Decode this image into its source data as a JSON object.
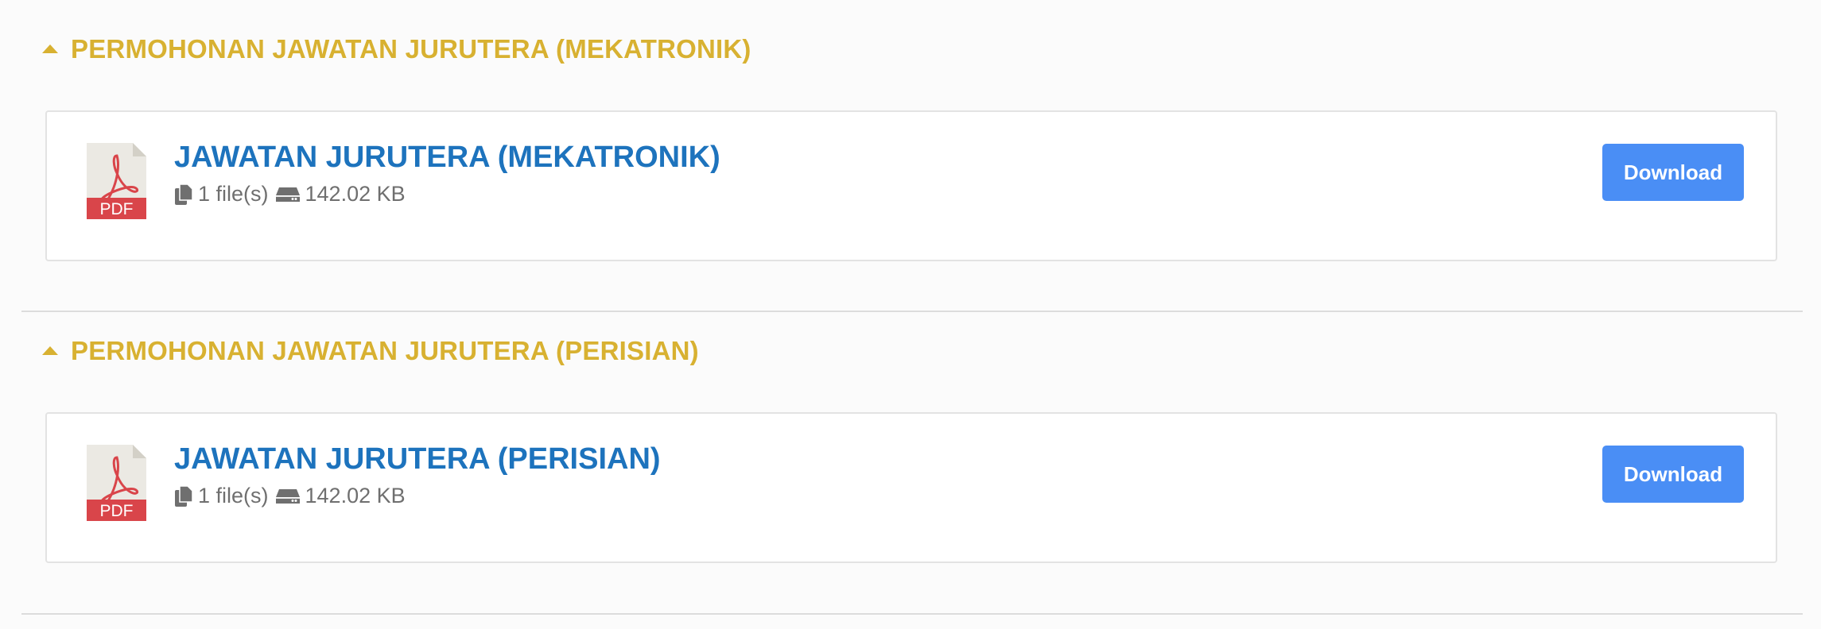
{
  "sections": [
    {
      "title": "PERMOHONAN JAWATAN JURUTERA (MEKATRONIK)",
      "file": {
        "icon_label": "PDF",
        "title": "JAWATAN JURUTERA (MEKATRONIK)",
        "files_count": "1 file(s)",
        "size": "142.02 KB",
        "download_label": "Download"
      }
    },
    {
      "title": "PERMOHONAN JAWATAN JURUTERA (PERISIAN)",
      "file": {
        "icon_label": "PDF",
        "title": "JAWATAN JURUTERA (PERISIAN)",
        "files_count": "1 file(s)",
        "size": "142.02 KB",
        "download_label": "Download"
      }
    }
  ],
  "colors": {
    "section_title": "#d8b131",
    "file_title": "#1d73bd",
    "download_button": "#4a8ef5",
    "pdf_badge": "#d9454a"
  }
}
